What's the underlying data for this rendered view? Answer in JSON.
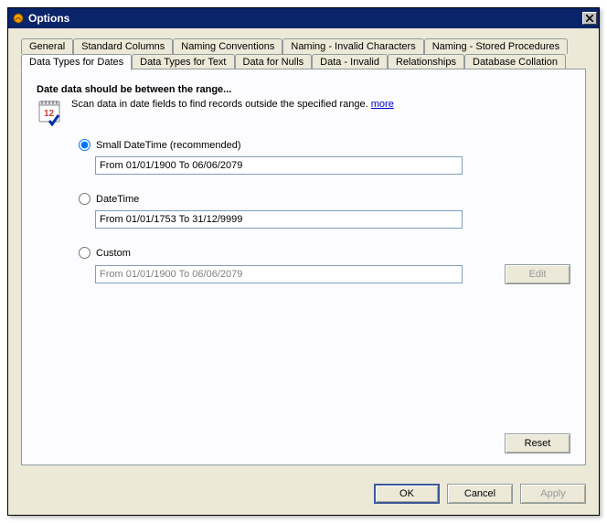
{
  "window": {
    "title": "Options"
  },
  "tabs_row1": [
    {
      "label": "General"
    },
    {
      "label": "Standard Columns"
    },
    {
      "label": "Naming Conventions"
    },
    {
      "label": "Naming - Invalid Characters"
    },
    {
      "label": "Naming - Stored Procedures"
    }
  ],
  "tabs_row2": [
    {
      "label": "Data Types for Dates",
      "active": true
    },
    {
      "label": "Data Types for Text"
    },
    {
      "label": "Data for Nulls"
    },
    {
      "label": "Data - Invalid"
    },
    {
      "label": "Relationships"
    },
    {
      "label": "Database Collation"
    }
  ],
  "page": {
    "heading": "Date data should be between the range...",
    "description": "Scan data in date fields to find records outside the specified range. ",
    "more_label": "more"
  },
  "options": {
    "small": {
      "label": "Small DateTime (recommended)",
      "value": "From 01/01/1900 To 06/06/2079",
      "checked": true
    },
    "datetime": {
      "label": "DateTime",
      "value": "From 01/01/1753 To 31/12/9999",
      "checked": false
    },
    "custom": {
      "label": "Custom",
      "value": "From 01/01/1900 To 06/06/2079",
      "checked": false
    }
  },
  "buttons": {
    "edit": "Edit",
    "reset": "Reset",
    "ok": "OK",
    "cancel": "Cancel",
    "apply": "Apply"
  }
}
